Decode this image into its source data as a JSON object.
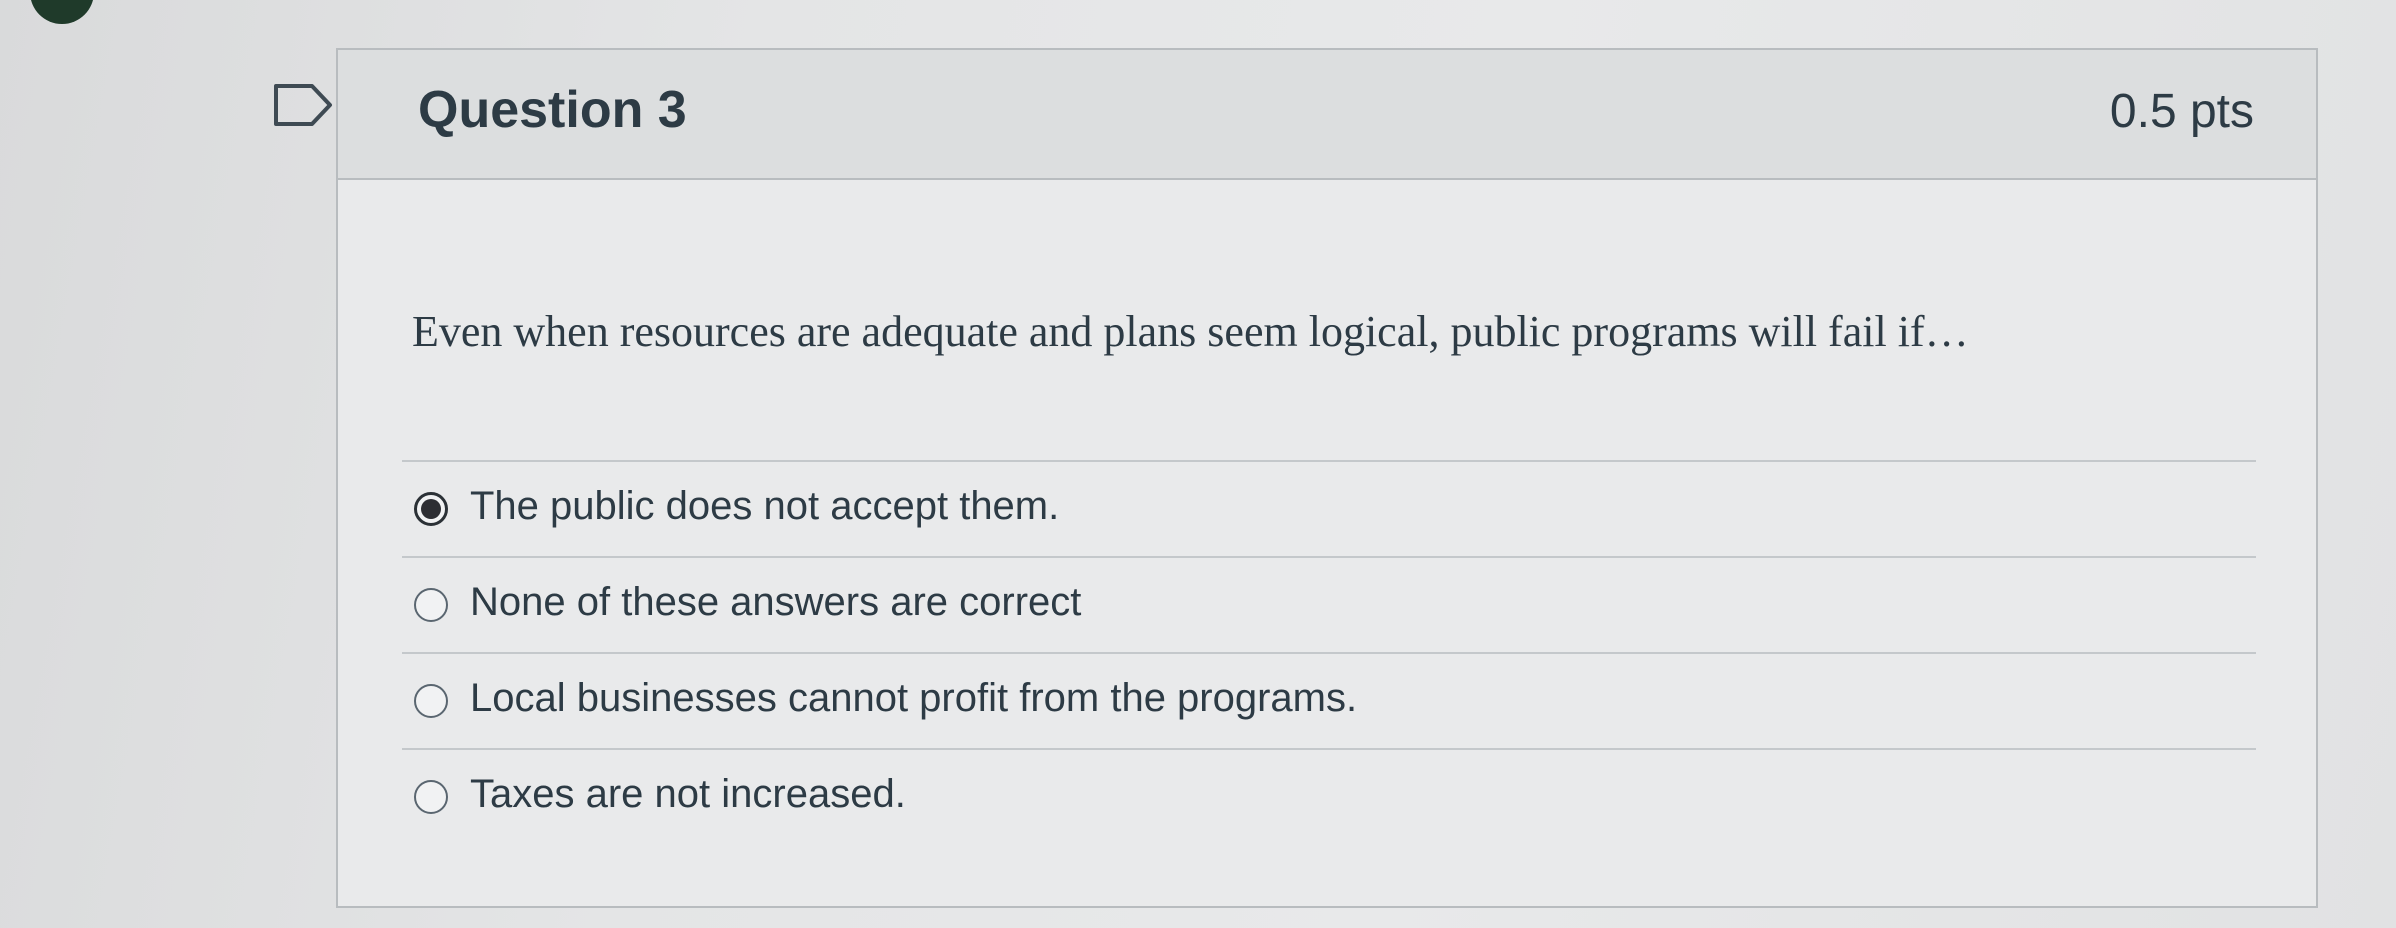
{
  "question": {
    "title": "Question 3",
    "points": "0.5 pts",
    "text": "Even when resources are adequate and plans seem logical, public programs will fail if…",
    "answers": [
      {
        "label": "The public does not accept them.",
        "selected": true
      },
      {
        "label": "None of these answers are correct",
        "selected": false
      },
      {
        "label": "Local businesses cannot profit from the programs.",
        "selected": false
      },
      {
        "label": "Taxes are not increased.",
        "selected": false
      }
    ]
  },
  "icons": {
    "flag": "flag-question-icon",
    "radio_selected": "radio-selected-icon",
    "radio_unselected": "radio-unselected-icon"
  }
}
